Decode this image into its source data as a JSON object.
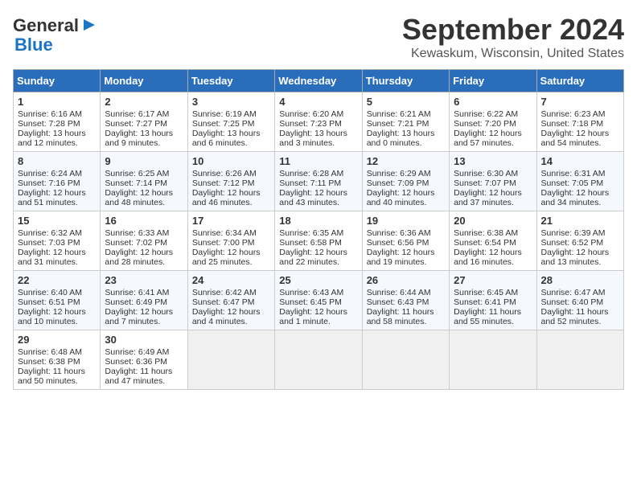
{
  "header": {
    "logo_line1": "General",
    "logo_line2": "Blue",
    "month_title": "September 2024",
    "location": "Kewaskum, Wisconsin, United States"
  },
  "weekdays": [
    "Sunday",
    "Monday",
    "Tuesday",
    "Wednesday",
    "Thursday",
    "Friday",
    "Saturday"
  ],
  "weeks": [
    [
      {
        "day": "1",
        "sunrise": "6:16 AM",
        "sunset": "7:28 PM",
        "daylight": "13 hours and 12 minutes."
      },
      {
        "day": "2",
        "sunrise": "6:17 AM",
        "sunset": "7:27 PM",
        "daylight": "13 hours and 9 minutes."
      },
      {
        "day": "3",
        "sunrise": "6:19 AM",
        "sunset": "7:25 PM",
        "daylight": "13 hours and 6 minutes."
      },
      {
        "day": "4",
        "sunrise": "6:20 AM",
        "sunset": "7:23 PM",
        "daylight": "13 hours and 3 minutes."
      },
      {
        "day": "5",
        "sunrise": "6:21 AM",
        "sunset": "7:21 PM",
        "daylight": "13 hours and 0 minutes."
      },
      {
        "day": "6",
        "sunrise": "6:22 AM",
        "sunset": "7:20 PM",
        "daylight": "12 hours and 57 minutes."
      },
      {
        "day": "7",
        "sunrise": "6:23 AM",
        "sunset": "7:18 PM",
        "daylight": "12 hours and 54 minutes."
      }
    ],
    [
      {
        "day": "8",
        "sunrise": "6:24 AM",
        "sunset": "7:16 PM",
        "daylight": "12 hours and 51 minutes."
      },
      {
        "day": "9",
        "sunrise": "6:25 AM",
        "sunset": "7:14 PM",
        "daylight": "12 hours and 48 minutes."
      },
      {
        "day": "10",
        "sunrise": "6:26 AM",
        "sunset": "7:12 PM",
        "daylight": "12 hours and 46 minutes."
      },
      {
        "day": "11",
        "sunrise": "6:28 AM",
        "sunset": "7:11 PM",
        "daylight": "12 hours and 43 minutes."
      },
      {
        "day": "12",
        "sunrise": "6:29 AM",
        "sunset": "7:09 PM",
        "daylight": "12 hours and 40 minutes."
      },
      {
        "day": "13",
        "sunrise": "6:30 AM",
        "sunset": "7:07 PM",
        "daylight": "12 hours and 37 minutes."
      },
      {
        "day": "14",
        "sunrise": "6:31 AM",
        "sunset": "7:05 PM",
        "daylight": "12 hours and 34 minutes."
      }
    ],
    [
      {
        "day": "15",
        "sunrise": "6:32 AM",
        "sunset": "7:03 PM",
        "daylight": "12 hours and 31 minutes."
      },
      {
        "day": "16",
        "sunrise": "6:33 AM",
        "sunset": "7:02 PM",
        "daylight": "12 hours and 28 minutes."
      },
      {
        "day": "17",
        "sunrise": "6:34 AM",
        "sunset": "7:00 PM",
        "daylight": "12 hours and 25 minutes."
      },
      {
        "day": "18",
        "sunrise": "6:35 AM",
        "sunset": "6:58 PM",
        "daylight": "12 hours and 22 minutes."
      },
      {
        "day": "19",
        "sunrise": "6:36 AM",
        "sunset": "6:56 PM",
        "daylight": "12 hours and 19 minutes."
      },
      {
        "day": "20",
        "sunrise": "6:38 AM",
        "sunset": "6:54 PM",
        "daylight": "12 hours and 16 minutes."
      },
      {
        "day": "21",
        "sunrise": "6:39 AM",
        "sunset": "6:52 PM",
        "daylight": "12 hours and 13 minutes."
      }
    ],
    [
      {
        "day": "22",
        "sunrise": "6:40 AM",
        "sunset": "6:51 PM",
        "daylight": "12 hours and 10 minutes."
      },
      {
        "day": "23",
        "sunrise": "6:41 AM",
        "sunset": "6:49 PM",
        "daylight": "12 hours and 7 minutes."
      },
      {
        "day": "24",
        "sunrise": "6:42 AM",
        "sunset": "6:47 PM",
        "daylight": "12 hours and 4 minutes."
      },
      {
        "day": "25",
        "sunrise": "6:43 AM",
        "sunset": "6:45 PM",
        "daylight": "12 hours and 1 minute."
      },
      {
        "day": "26",
        "sunrise": "6:44 AM",
        "sunset": "6:43 PM",
        "daylight": "11 hours and 58 minutes."
      },
      {
        "day": "27",
        "sunrise": "6:45 AM",
        "sunset": "6:41 PM",
        "daylight": "11 hours and 55 minutes."
      },
      {
        "day": "28",
        "sunrise": "6:47 AM",
        "sunset": "6:40 PM",
        "daylight": "11 hours and 52 minutes."
      }
    ],
    [
      {
        "day": "29",
        "sunrise": "6:48 AM",
        "sunset": "6:38 PM",
        "daylight": "11 hours and 50 minutes."
      },
      {
        "day": "30",
        "sunrise": "6:49 AM",
        "sunset": "6:36 PM",
        "daylight": "11 hours and 47 minutes."
      },
      null,
      null,
      null,
      null,
      null
    ]
  ]
}
